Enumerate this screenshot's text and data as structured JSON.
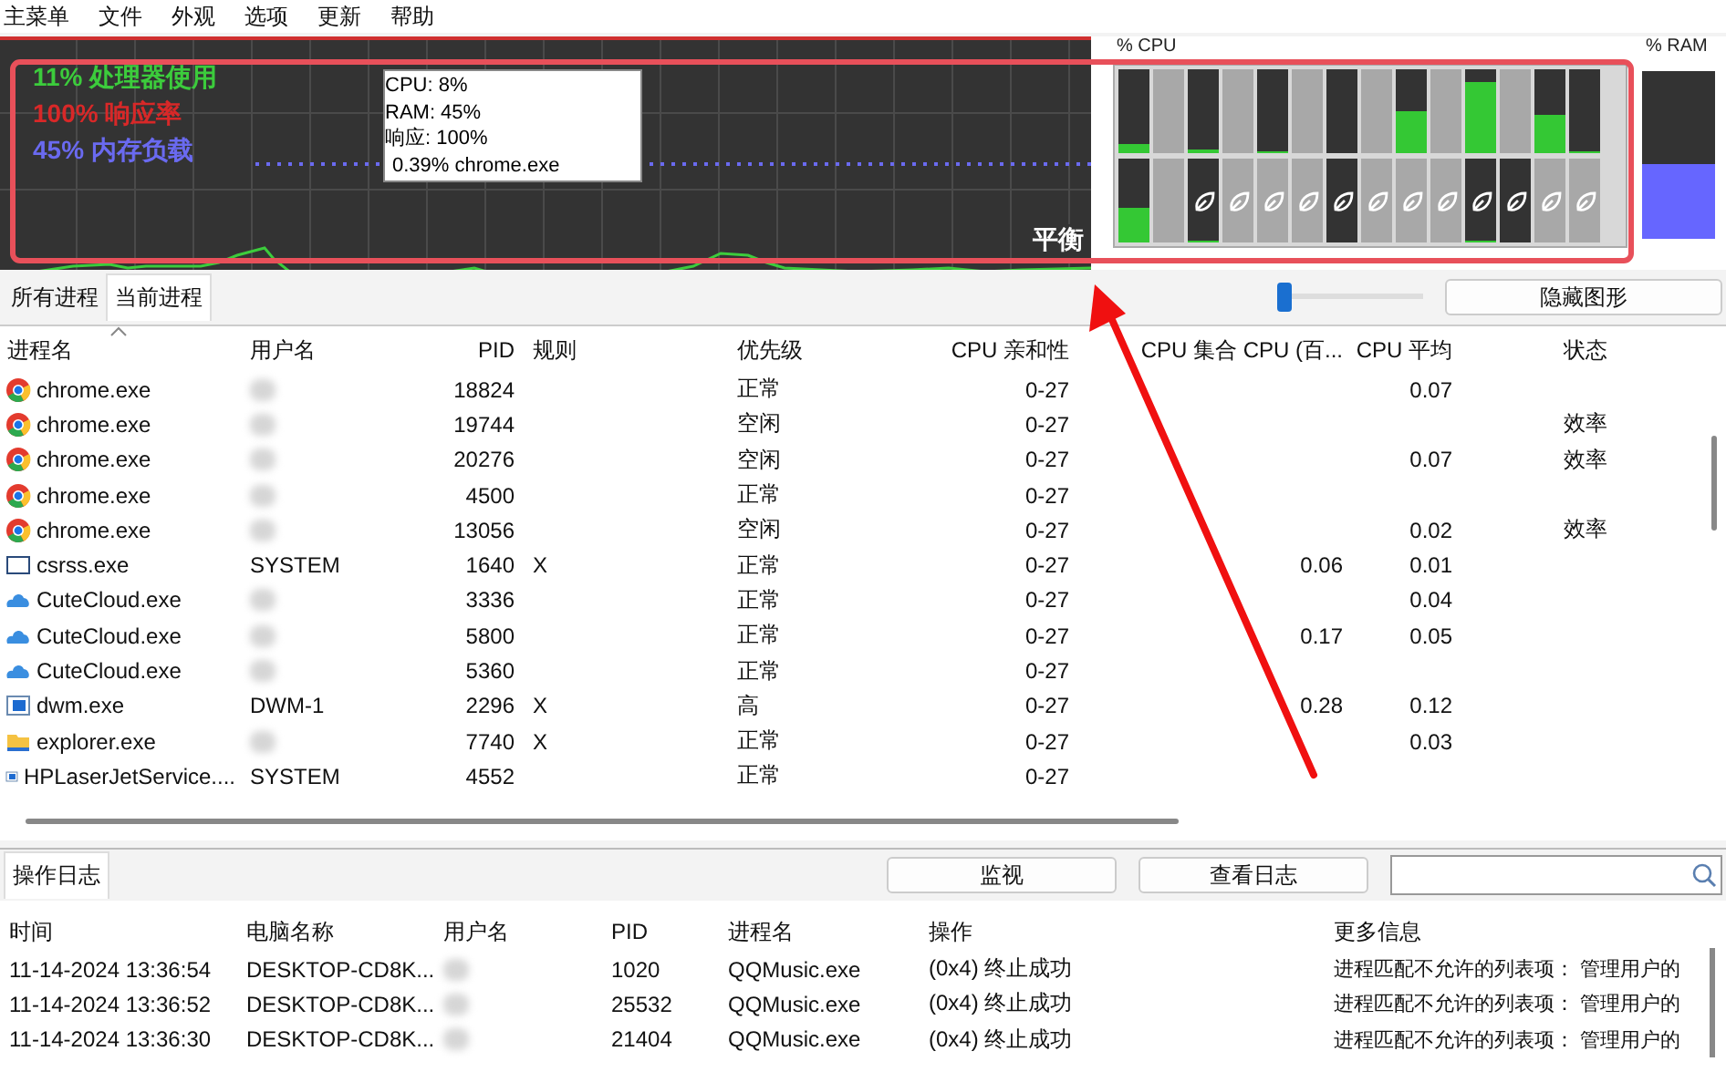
{
  "menu": [
    "主菜单",
    "文件",
    "外观",
    "选项",
    "更新",
    "帮助"
  ],
  "graph": {
    "legend": [
      {
        "text": "11% 处理器使用",
        "color": "#3ccc3c"
      },
      {
        "text": "100% 响应率",
        "color": "#d82828"
      },
      {
        "text": "45% 内存负载",
        "color": "#6a6af0"
      }
    ],
    "tooltip": [
      "CPU: 8%",
      "RAM: 45%",
      "响应: 100%",
      "0.39% chrome.exe"
    ],
    "power_plan": "平衡"
  },
  "cpu_panel": {
    "title": "% CPU",
    "rows": [
      [
        {
          "parked": false,
          "eco": false,
          "level": 0.1
        },
        {
          "parked": true,
          "eco": false
        },
        {
          "parked": false,
          "eco": false,
          "level": 0.05
        },
        {
          "parked": true,
          "eco": false
        },
        {
          "parked": false,
          "eco": false,
          "level": 0.02
        },
        {
          "parked": true,
          "eco": false
        },
        {
          "parked": false,
          "eco": false
        },
        {
          "parked": true,
          "eco": false
        },
        {
          "parked": false,
          "eco": false,
          "level": 0.5
        },
        {
          "parked": true,
          "eco": false
        },
        {
          "parked": false,
          "eco": false,
          "level": 0.85
        },
        {
          "parked": true,
          "eco": false
        },
        {
          "parked": false,
          "eco": false,
          "level": 0.46
        },
        {
          "parked": false,
          "eco": false,
          "level": 0.02
        }
      ],
      [
        {
          "parked": false,
          "eco": false,
          "level": 0.42
        },
        {
          "parked": true,
          "eco": false
        },
        {
          "parked": false,
          "eco": true,
          "level": 0.03
        },
        {
          "parked": true,
          "eco": true
        },
        {
          "parked": true,
          "eco": true
        },
        {
          "parked": true,
          "eco": true
        },
        {
          "parked": false,
          "eco": true
        },
        {
          "parked": true,
          "eco": true
        },
        {
          "parked": true,
          "eco": true
        },
        {
          "parked": true,
          "eco": true
        },
        {
          "parked": false,
          "eco": true,
          "level": 0.03
        },
        {
          "parked": false,
          "eco": true
        },
        {
          "parked": true,
          "eco": true
        },
        {
          "parked": true,
          "eco": true
        }
      ]
    ]
  },
  "ram_panel": {
    "title": "% RAM",
    "level": 0.45
  },
  "tabs": [
    {
      "label": "所有进程",
      "selected": false
    },
    {
      "label": "当前进程",
      "selected": true
    }
  ],
  "graph_slider": {
    "level": 0.05
  },
  "hide_graph_button": "隐藏图形",
  "process_table": {
    "columns": [
      "进程名",
      "用户名",
      "PID",
      "规则",
      "优先级",
      "CPU 亲和性",
      "CPU 集合",
      "CPU (百...",
      "CPU 平均",
      "状态"
    ],
    "rows": [
      {
        "kind": "chrome",
        "name": "chrome.exe",
        "user_hidden": true,
        "pid": "18824",
        "priority": "正常",
        "affinity": "0-27",
        "avg": "0.07"
      },
      {
        "kind": "chrome",
        "name": "chrome.exe",
        "user_hidden": true,
        "pid": "19744",
        "priority": "空闲",
        "affinity": "0-27",
        "status": "效率"
      },
      {
        "kind": "chrome",
        "name": "chrome.exe",
        "user_hidden": true,
        "pid": "20276",
        "priority": "空闲",
        "affinity": "0-27",
        "avg": "0.07",
        "status": "效率"
      },
      {
        "kind": "chrome",
        "name": "chrome.exe",
        "user_hidden": true,
        "pid": "4500",
        "priority": "正常",
        "affinity": "0-27"
      },
      {
        "kind": "chrome",
        "name": "chrome.exe",
        "user_hidden": true,
        "pid": "13056",
        "priority": "空闲",
        "affinity": "0-27",
        "avg": "0.02",
        "status": "效率"
      },
      {
        "kind": "window",
        "name": "csrss.exe",
        "user": "SYSTEM",
        "user_hidden": false,
        "pid": "1640",
        "rule": "X",
        "priority": "正常",
        "affinity": "0-27",
        "cpu": "0.06",
        "avg": "0.01"
      },
      {
        "kind": "cloud",
        "name": "CuteCloud.exe",
        "user_hidden": true,
        "pid": "3336",
        "priority": "正常",
        "affinity": "0-27",
        "avg": "0.04"
      },
      {
        "kind": "cloud",
        "name": "CuteCloud.exe",
        "user_hidden": true,
        "pid": "5800",
        "priority": "正常",
        "affinity": "0-27",
        "cpu": "0.17",
        "avg": "0.05"
      },
      {
        "kind": "cloud",
        "name": "CuteCloud.exe",
        "user_hidden": true,
        "pid": "5360",
        "priority": "正常",
        "affinity": "0-27"
      },
      {
        "kind": "app",
        "name": "dwm.exe",
        "user": "DWM-1",
        "user_hidden": false,
        "pid": "2296",
        "rule": "X",
        "priority": "高",
        "affinity": "0-27",
        "cpu": "0.28",
        "avg": "0.12"
      },
      {
        "kind": "folder",
        "name": "explorer.exe",
        "user_hidden": true,
        "pid": "7740",
        "rule": "X",
        "priority": "正常",
        "affinity": "0-27",
        "avg": "0.03"
      },
      {
        "kind": "app",
        "name": "HPLaserJetService....",
        "user": "SYSTEM",
        "user_hidden": false,
        "pid": "4552",
        "priority": "正常",
        "affinity": "0-27"
      }
    ]
  },
  "log": {
    "tab": {
      "label": "操作日志",
      "selected": true
    },
    "buttons": [
      "监视",
      "查看日志"
    ],
    "columns": [
      "时间",
      "电脑名称",
      "用户名",
      "PID",
      "进程名",
      "操作",
      "更多信息"
    ],
    "rows": [
      {
        "time": "11-14-2024 13:36:54",
        "computer": "DESKTOP-CD8K...",
        "user_hidden": true,
        "pid": "1020",
        "process": "QQMusic.exe",
        "action": "(0x4) 终止成功",
        "info": "进程匹配不允许的列表项：  管理用户的"
      },
      {
        "time": "11-14-2024 13:36:52",
        "computer": "DESKTOP-CD8K...",
        "user_hidden": true,
        "pid": "25532",
        "process": "QQMusic.exe",
        "action": "(0x4) 终止成功",
        "info": "进程匹配不允许的列表项：  管理用户的"
      },
      {
        "time": "11-14-2024 13:36:30",
        "computer": "DESKTOP-CD8K...",
        "user_hidden": true,
        "pid": "21404",
        "process": "QQMusic.exe",
        "action": "(0x4) 终止成功",
        "info": "进程匹配不允许的列表项：  管理用户的"
      }
    ]
  }
}
